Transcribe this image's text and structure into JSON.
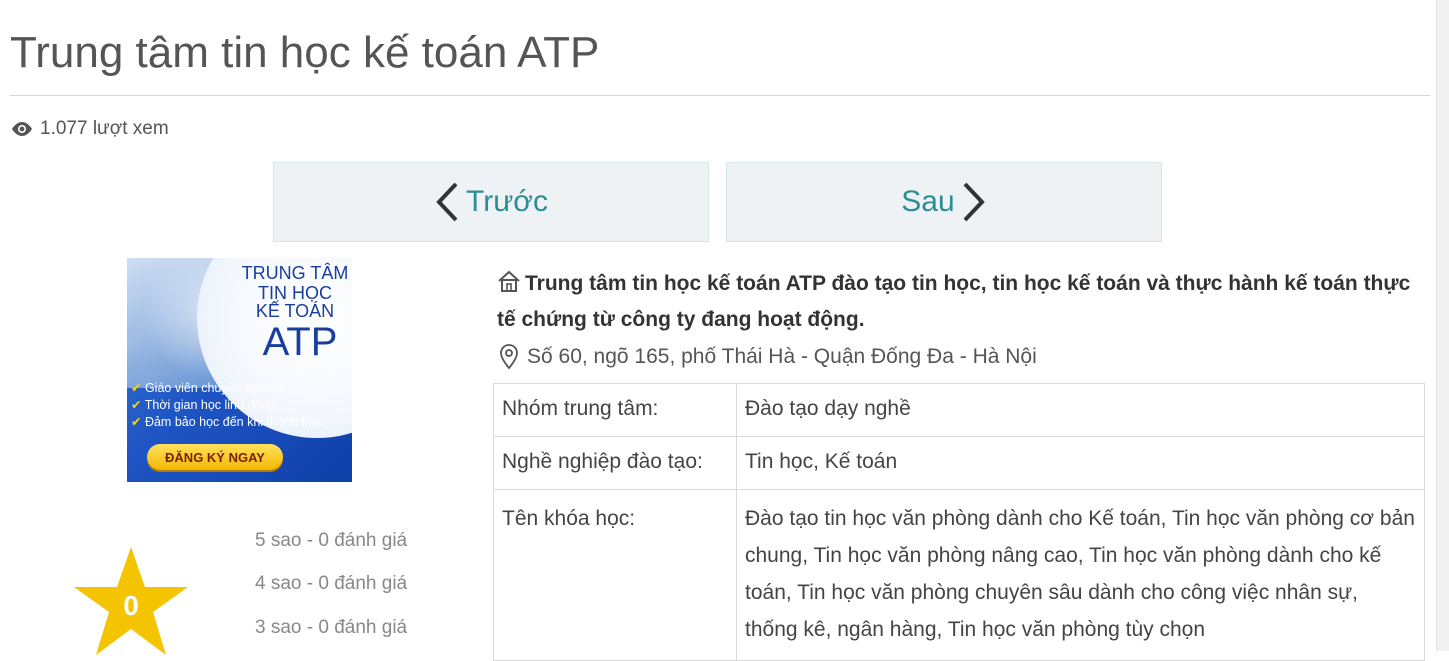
{
  "page": {
    "title": "Trung tâm tin học kế toán ATP",
    "views": "1.077 lượt xem"
  },
  "nav": {
    "prev_label": "Trước",
    "next_label": "Sau"
  },
  "banner": {
    "line1": "TRUNG TÂM",
    "line2": "TIN HỌC",
    "line3": "KẾ TOÁN",
    "line4": "ATP",
    "bullets": [
      "Giáo viên chuyên nghiệp",
      "Thời gian học linh động",
      "Đảm bảo học đến khi thành thạo"
    ],
    "cta": "ĐĂNG KÝ NGAY"
  },
  "rating": {
    "score": "0",
    "lines": [
      "5 sao - 0 đánh giá",
      "4 sao - 0 đánh giá",
      "3 sao - 0 đánh giá"
    ]
  },
  "detail": {
    "summary": "Trung tâm tin học kế toán ATP đào tạo tin học, tin học kế toán và thực hành kế toán thực tế chứng từ công ty đang hoạt động.",
    "address": "Số 60, ngõ 165, phố Thái Hà - Quận Đống Đa - Hà Nội",
    "table": [
      {
        "key": "Nhóm trung tâm:",
        "value": "Đào tạo dạy nghề"
      },
      {
        "key": "Nghề nghiệp đào tạo:",
        "value": "Tin học, Kế toán"
      },
      {
        "key": "Tên khóa học:",
        "value": "Đào tạo tin học văn phòng dành cho Kế toán, Tin học văn phòng cơ bản chung, Tin học văn phòng nâng cao, Tin học văn phòng dành cho kế toán, Tin học văn phòng chuyên sâu dành cho công việc nhân sự, thống kê, ngân hàng, Tin học văn phòng tùy chọn"
      }
    ]
  },
  "colors": {
    "accent": "#2a8f94",
    "star": "#f5c400"
  }
}
